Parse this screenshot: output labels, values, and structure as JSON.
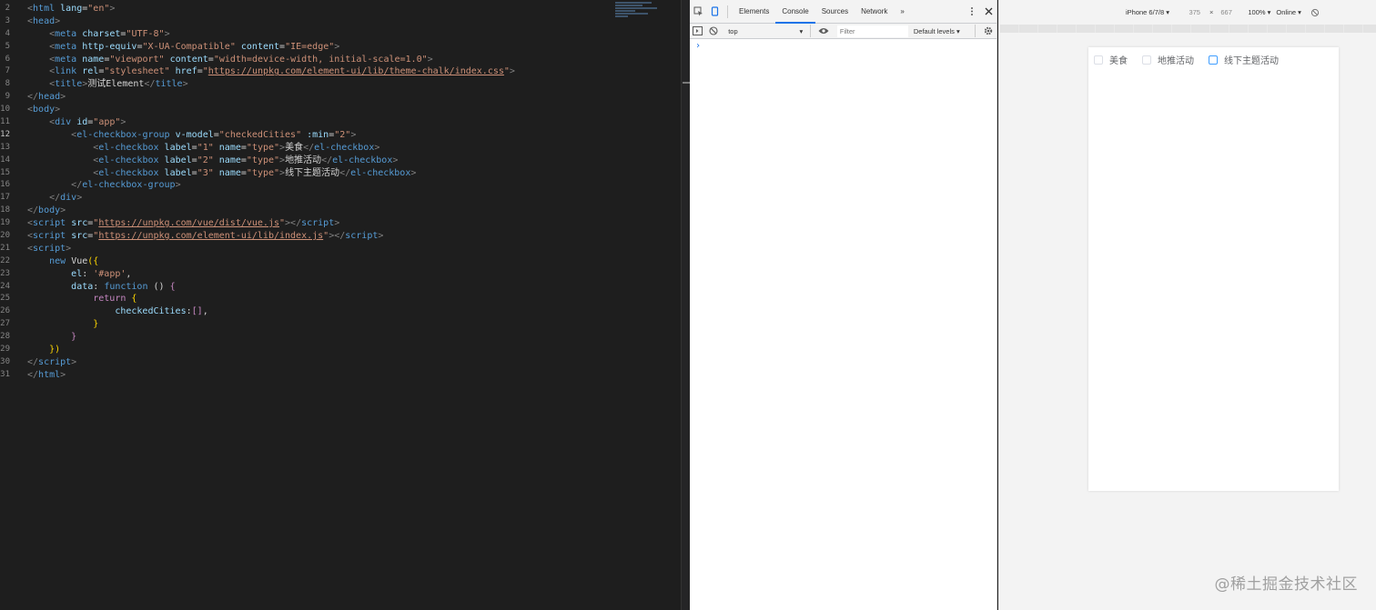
{
  "editor": {
    "active_line": "12",
    "lines": [
      {
        "n": "2",
        "html": "<span class='tag'>&lt;</span><span class='tn'>html</span> <span class='at'>lang</span><span class='pu'>=</span><span class='av'>\"en\"</span><span class='tag'>&gt;</span>"
      },
      {
        "n": "3",
        "html": "<span class='tag'>&lt;</span><span class='tn'>head</span><span class='tag'>&gt;</span>"
      },
      {
        "n": "4",
        "html": "    <span class='tag'>&lt;</span><span class='tn'>meta</span> <span class='at'>charset</span><span class='pu'>=</span><span class='av'>\"UTF-8\"</span><span class='tag'>&gt;</span>"
      },
      {
        "n": "5",
        "html": "    <span class='tag'>&lt;</span><span class='tn'>meta</span> <span class='at'>http-equiv</span><span class='pu'>=</span><span class='av'>\"X-UA-Compatible\"</span> <span class='at'>content</span><span class='pu'>=</span><span class='av'>\"IE=edge\"</span><span class='tag'>&gt;</span>"
      },
      {
        "n": "6",
        "html": "    <span class='tag'>&lt;</span><span class='tn'>meta</span> <span class='at'>name</span><span class='pu'>=</span><span class='av'>\"viewport\"</span> <span class='at'>content</span><span class='pu'>=</span><span class='av'>\"width=device-width, initial-scale=1.0\"</span><span class='tag'>&gt;</span>"
      },
      {
        "n": "7",
        "html": "    <span class='tag'>&lt;</span><span class='tn'>link</span> <span class='at'>rel</span><span class='pu'>=</span><span class='av'>\"stylesheet\"</span> <span class='at'>href</span><span class='pu'>=</span><span class='av'>\"</span><span class='url'>https://unpkg.com/element-ui/lib/theme-chalk/index.css</span><span class='av'>\"</span><span class='tag'>&gt;</span>"
      },
      {
        "n": "8",
        "html": "    <span class='tag'>&lt;</span><span class='tn'>title</span><span class='tag'>&gt;</span><span class='tx'>测试Element</span><span class='tag'>&lt;/</span><span class='tn'>title</span><span class='tag'>&gt;</span>"
      },
      {
        "n": "9",
        "html": "<span class='tag'>&lt;/</span><span class='tn'>head</span><span class='tag'>&gt;</span>"
      },
      {
        "n": "10",
        "html": "<span class='tag'>&lt;</span><span class='tn'>body</span><span class='tag'>&gt;</span>"
      },
      {
        "n": "11",
        "html": "    <span class='tag'>&lt;</span><span class='tn'>div</span> <span class='at'>id</span><span class='pu'>=</span><span class='av'>\"app\"</span><span class='tag'>&gt;</span>"
      },
      {
        "n": "12",
        "html": "        <span class='tag'>&lt;</span><span class='tn'>el-checkbox-group</span> <span class='at'>v-model</span><span class='pu'>=</span><span class='av'>\"checkedCities\"</span> <span class='at'>:min</span><span class='pu'>=</span><span class='av'>\"2\"</span><span class='tag'>&gt;</span>"
      },
      {
        "n": "13",
        "html": "            <span class='tag'>&lt;</span><span class='tn'>el-checkbox</span> <span class='at'>label</span><span class='pu'>=</span><span class='av'>\"1\"</span> <span class='at'>name</span><span class='pu'>=</span><span class='av'>\"type\"</span><span class='tag'>&gt;</span><span class='tx'>美食</span><span class='tag'>&lt;/</span><span class='tn'>el-checkbox</span><span class='tag'>&gt;</span>"
      },
      {
        "n": "14",
        "html": "            <span class='tag'>&lt;</span><span class='tn'>el-checkbox</span> <span class='at'>label</span><span class='pu'>=</span><span class='av'>\"2\"</span> <span class='at'>name</span><span class='pu'>=</span><span class='av'>\"type\"</span><span class='tag'>&gt;</span><span class='tx'>地推活动</span><span class='tag'>&lt;/</span><span class='tn'>el-checkbox</span><span class='tag'>&gt;</span>"
      },
      {
        "n": "15",
        "html": "            <span class='tag'>&lt;</span><span class='tn'>el-checkbox</span> <span class='at'>label</span><span class='pu'>=</span><span class='av'>\"3\"</span> <span class='at'>name</span><span class='pu'>=</span><span class='av'>\"type\"</span><span class='tag'>&gt;</span><span class='tx'>线下主题活动</span><span class='tag'>&lt;/</span><span class='tn'>el-checkbox</span><span class='tag'>&gt;</span>"
      },
      {
        "n": "16",
        "html": "        <span class='tag'>&lt;/</span><span class='tn'>el-checkbox-group</span><span class='tag'>&gt;</span>"
      },
      {
        "n": "17",
        "html": "    <span class='tag'>&lt;/</span><span class='tn'>div</span><span class='tag'>&gt;</span>"
      },
      {
        "n": "18",
        "html": "<span class='tag'>&lt;/</span><span class='tn'>body</span><span class='tag'>&gt;</span>"
      },
      {
        "n": "19",
        "html": "<span class='tag'>&lt;</span><span class='tn'>script</span> <span class='at'>src</span><span class='pu'>=</span><span class='av'>\"</span><span class='url'>https://unpkg.com/vue/dist/vue.js</span><span class='av'>\"</span><span class='tag'>&gt;&lt;/</span><span class='tn'>script</span><span class='tag'>&gt;</span>"
      },
      {
        "n": "20",
        "html": "<span class='tag'>&lt;</span><span class='tn'>script</span> <span class='at'>src</span><span class='pu'>=</span><span class='av'>\"</span><span class='url'>https://unpkg.com/element-ui/lib/index.js</span><span class='av'>\"</span><span class='tag'>&gt;&lt;/</span><span class='tn'>script</span><span class='tag'>&gt;</span>"
      },
      {
        "n": "21",
        "html": "<span class='tag'>&lt;</span><span class='tn'>script</span><span class='tag'>&gt;</span>"
      },
      {
        "n": "22",
        "html": "    <span class='kw'>new</span> <span class='tx'>Vue</span><span class='br'>({</span>"
      },
      {
        "n": "23",
        "html": "        <span class='at'>el</span><span class='pu'>: </span><span class='av'>'#app'</span><span class='pu'>,</span>"
      },
      {
        "n": "24",
        "html": "        <span class='at'>data</span><span class='pu'>: </span><span class='kw'>function</span> <span class='pu'>() </span><span class='kc'>{</span>"
      },
      {
        "n": "25",
        "html": "            <span class='kc'>return</span> <span class='br'>{</span>"
      },
      {
        "n": "26",
        "html": "                <span class='at'>checkedCities</span><span class='pu'>:</span><span class='kc'>[]</span><span class='pu'>,</span>"
      },
      {
        "n": "27",
        "html": "            <span class='br'>}</span>"
      },
      {
        "n": "28",
        "html": "        <span class='kc'>}</span>"
      },
      {
        "n": "29",
        "html": "    <span class='br'>})</span>"
      },
      {
        "n": "30",
        "html": "<span class='tag'>&lt;/</span><span class='tn'>script</span><span class='tag'>&gt;</span>"
      },
      {
        "n": "31",
        "html": "<span class='tag'>&lt;/</span><span class='tn'>html</span><span class='tag'>&gt;</span>"
      }
    ]
  },
  "devtools": {
    "tabs": [
      "Elements",
      "Console",
      "Sources",
      "Network"
    ],
    "active_tab": "Console",
    "more_glyph": "»",
    "context": "top",
    "filter_placeholder": "Filter",
    "levels": "Default levels ▾",
    "prompt_glyph": "›"
  },
  "device": {
    "name": "iPhone 6/7/8 ▾",
    "width": "375",
    "times": "×",
    "height": "667",
    "zoom": "100% ▾",
    "network": "Online ▾"
  },
  "checkbox_group": {
    "items": [
      {
        "label": "美食"
      },
      {
        "label": "地推活动"
      },
      {
        "label": "线下主题活动"
      }
    ]
  },
  "watermark": "@稀土掘金技术社区",
  "icons": {
    "inspect": "inspect-icon",
    "device": "device-toolbar-icon",
    "menu": "kebab-menu-icon",
    "close": "close-icon",
    "sidebar": "sidebar-toggle-icon",
    "clear": "clear-console-icon",
    "eye": "live-expression-icon",
    "settings": "gear-icon",
    "rotate": "rotate-icon"
  },
  "colors": {
    "editor_bg": "#1e1e1e",
    "accent": "#1a73e8",
    "checkbox_focus": "#409eff",
    "checkbox_border": "#dcdfe6"
  }
}
